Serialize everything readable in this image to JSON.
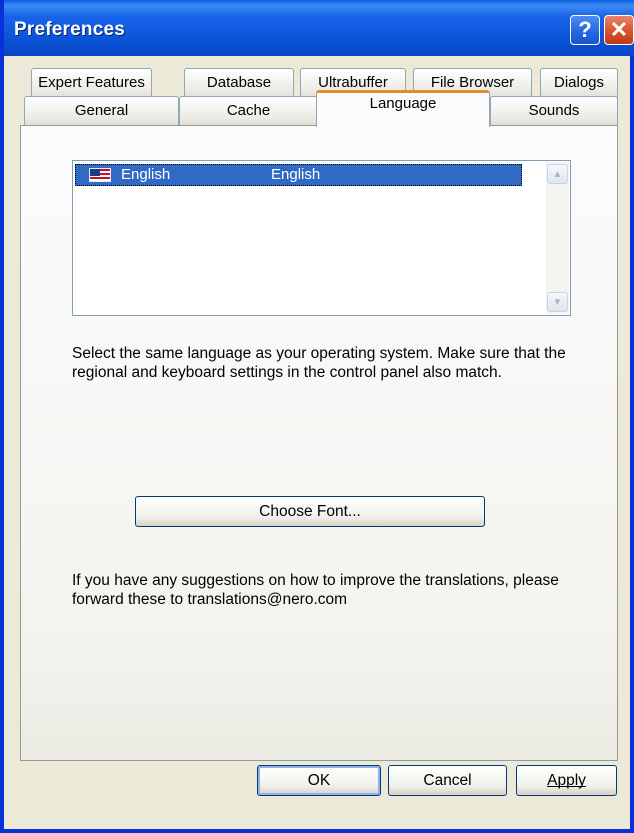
{
  "window": {
    "title": "Preferences",
    "help_icon": "help-icon",
    "close_icon": "close-icon"
  },
  "tabs": {
    "row1": [
      {
        "label": "Expert Features"
      },
      {
        "label": "Database"
      },
      {
        "label": "Ultrabuffer"
      },
      {
        "label": "File Browser"
      },
      {
        "label": "Dialogs"
      }
    ],
    "row2": [
      {
        "label": "General"
      },
      {
        "label": "Cache"
      },
      {
        "label": "Language",
        "active": true
      },
      {
        "label": "Sounds"
      }
    ]
  },
  "language_list": {
    "items": [
      {
        "name": "English",
        "native": "English",
        "icon": "us-flag-icon",
        "selected": true
      }
    ]
  },
  "panel": {
    "description": "Select the same language as your operating system. Make sure that the regional and keyboard settings in the control panel also match.",
    "choose_font_label": "Choose Font...",
    "suggestion_text": "If you have any suggestions on how to improve the translations, please forward these to translations@nero.com"
  },
  "footer": {
    "ok_label": "OK",
    "cancel_label": "Cancel",
    "apply_label": "Apply"
  },
  "colors": {
    "titlebar": "#0b54d8",
    "selection": "#316ac5",
    "active_tab_accent": "#e68b2c",
    "dialog_bg": "#ece9d8"
  }
}
